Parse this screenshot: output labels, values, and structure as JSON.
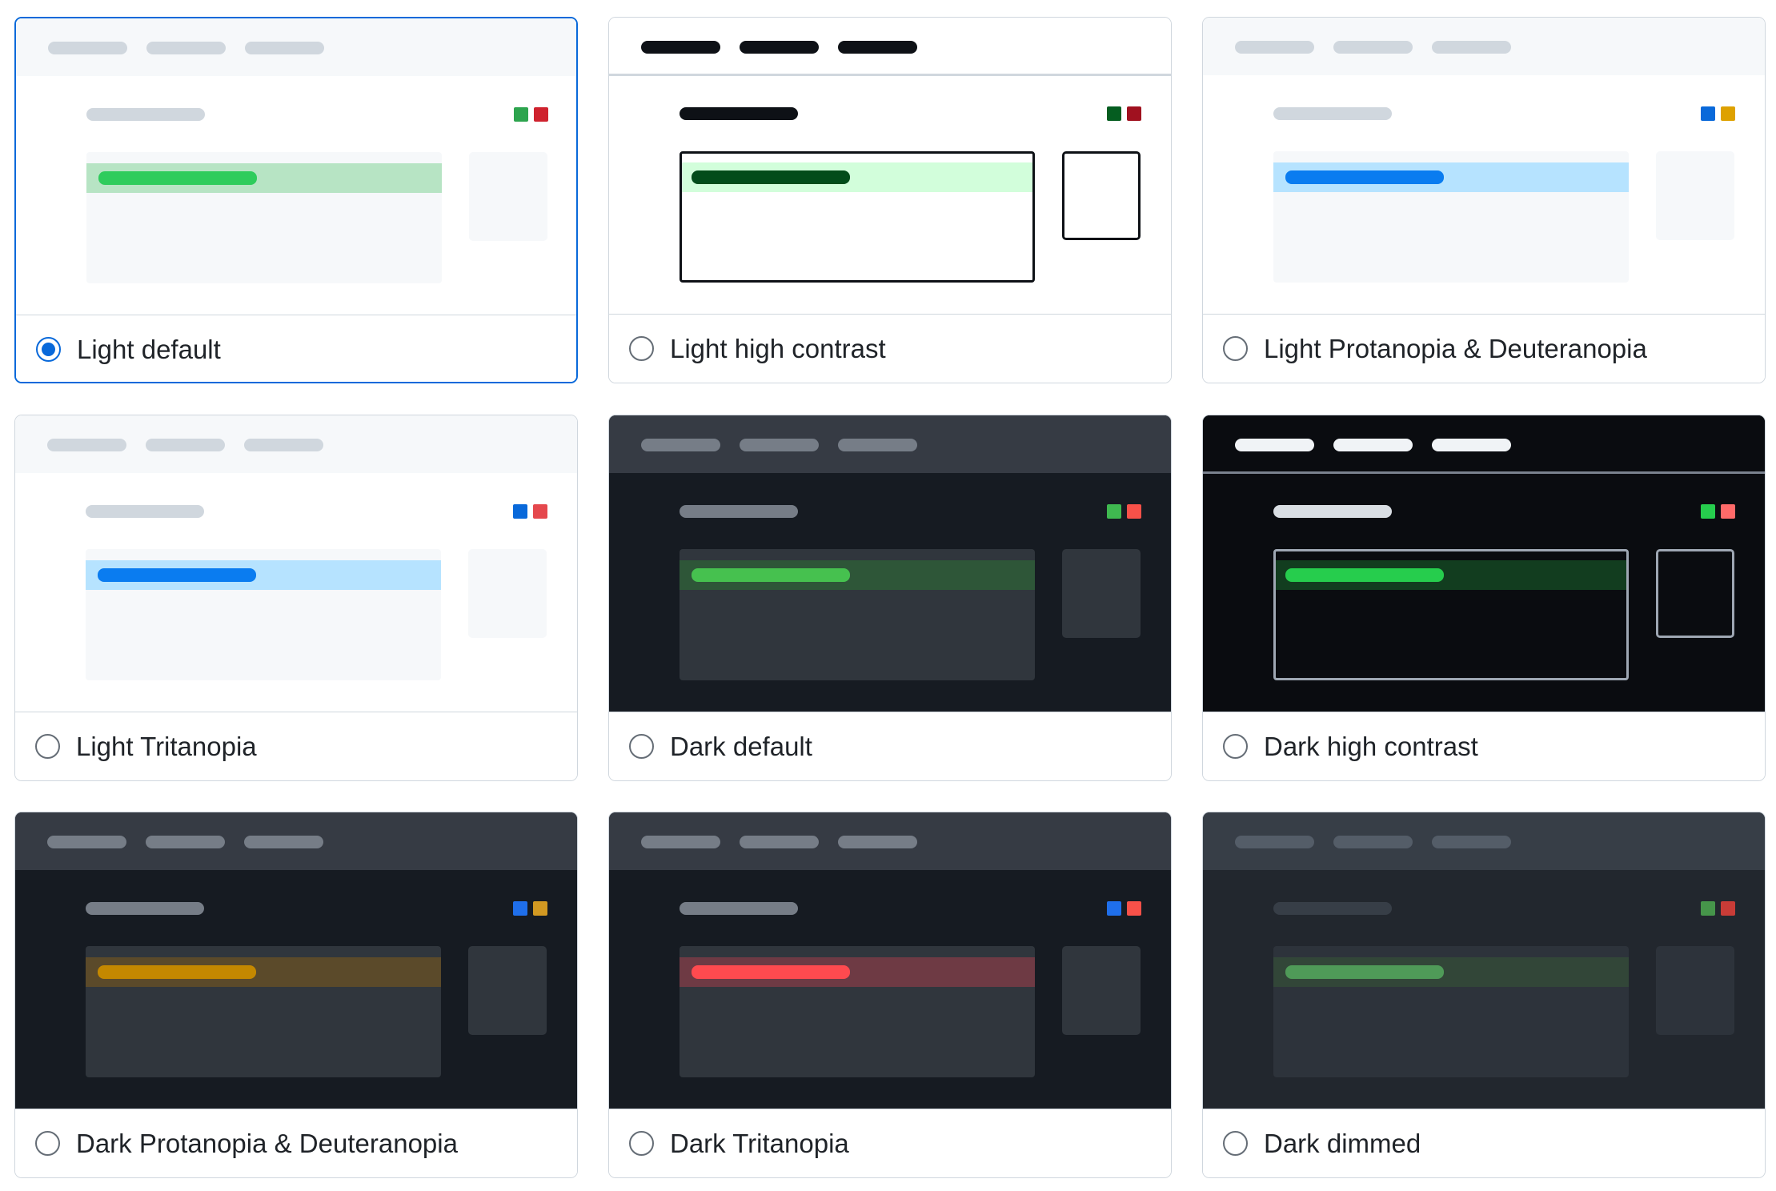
{
  "themes": [
    {
      "label": "Light default",
      "selected": true,
      "colors": {
        "bg": "#ffffff",
        "header": "#f6f8fa",
        "headerPill": "#d0d7de",
        "rule": "",
        "titlePill": "#d0d7de",
        "swatch1": "#2da44e",
        "swatch2": "#cf222e",
        "panel": "#f6f8fa",
        "panelBorder": "",
        "row": "#b7e4c4",
        "bar": "#2ecc5c",
        "side": "#f6f8fa",
        "sideBorder": ""
      }
    },
    {
      "label": "Light high contrast",
      "selected": false,
      "colors": {
        "bg": "#ffffff",
        "header": "#ffffff",
        "headerPill": "#0e1116",
        "rule": "#d0d7de",
        "titlePill": "#0e1116",
        "swatch1": "#055d20",
        "swatch2": "#a0111f",
        "panel": "#ffffff",
        "panelBorder": "#0e1116",
        "row": "#d2fedb",
        "bar": "#024c1a",
        "side": "#ffffff",
        "sideBorder": "#0e1116"
      }
    },
    {
      "label": "Light Protanopia & Deuteranopia",
      "selected": false,
      "colors": {
        "bg": "#ffffff",
        "header": "#f6f8fa",
        "headerPill": "#d0d7de",
        "rule": "",
        "titlePill": "#d0d7de",
        "swatch1": "#0969da",
        "swatch2": "#dea100",
        "panel": "#f6f8fa",
        "panelBorder": "",
        "row": "#b6e3ff",
        "bar": "#0a7cf0",
        "side": "#f6f8fa",
        "sideBorder": ""
      }
    },
    {
      "label": "Light Tritanopia",
      "selected": false,
      "colors": {
        "bg": "#ffffff",
        "header": "#f6f8fa",
        "headerPill": "#d0d7de",
        "rule": "",
        "titlePill": "#d0d7de",
        "swatch1": "#0969da",
        "swatch2": "#e5484d",
        "panel": "#f6f8fa",
        "panelBorder": "",
        "row": "#b6e3ff",
        "bar": "#0a7cf0",
        "side": "#f6f8fa",
        "sideBorder": ""
      }
    },
    {
      "label": "Dark default",
      "selected": false,
      "colors": {
        "bg": "#161b22",
        "header": "#363b44",
        "headerPill": "#767d87",
        "rule": "",
        "titlePill": "#767d87",
        "swatch1": "#3fb950",
        "swatch2": "#f85149",
        "panel": "#30363d",
        "panelBorder": "",
        "row": "#2e5638",
        "bar": "#46c14f",
        "side": "#30363d",
        "sideBorder": ""
      }
    },
    {
      "label": "Dark high contrast",
      "selected": false,
      "colors": {
        "bg": "#0a0c10",
        "header": "#0a0c10",
        "headerPill": "#f0f3f6",
        "rule": "#7a828e",
        "titlePill": "#d9dee3",
        "swatch1": "#26cd4d",
        "swatch2": "#ff6a69",
        "panel": "#0a0c10",
        "panelBorder": "#9ea7b3",
        "row": "#123d1f",
        "bar": "#26cd4d",
        "side": "#0a0c10",
        "sideBorder": "#9ea7b3"
      }
    },
    {
      "label": "Dark Protanopia & Deuteranopia",
      "selected": false,
      "colors": {
        "bg": "#161b22",
        "header": "#363b44",
        "headerPill": "#767d87",
        "rule": "",
        "titlePill": "#767d87",
        "swatch1": "#1f6feb",
        "swatch2": "#d29922",
        "panel": "#30363d",
        "panelBorder": "",
        "row": "#5b4a2a",
        "bar": "#c48800",
        "side": "#30363d",
        "sideBorder": ""
      }
    },
    {
      "label": "Dark Tritanopia",
      "selected": false,
      "colors": {
        "bg": "#161b22",
        "header": "#363b44",
        "headerPill": "#767d87",
        "rule": "",
        "titlePill": "#767d87",
        "swatch1": "#1f6feb",
        "swatch2": "#f85149",
        "panel": "#30363d",
        "panelBorder": "",
        "row": "#6e3a44",
        "bar": "#ff4a4f",
        "side": "#30363d",
        "sideBorder": ""
      }
    },
    {
      "label": "Dark dimmed",
      "selected": false,
      "colors": {
        "bg": "#22272e",
        "header": "#373e47",
        "headerPill": "#545d68",
        "rule": "",
        "titlePill": "#373e47",
        "swatch1": "#46954a",
        "swatch2": "#c93c37",
        "panel": "#2d333b",
        "panelBorder": "",
        "row": "#324638",
        "bar": "#4f9a58",
        "side": "#2d333b",
        "sideBorder": ""
      }
    }
  ]
}
